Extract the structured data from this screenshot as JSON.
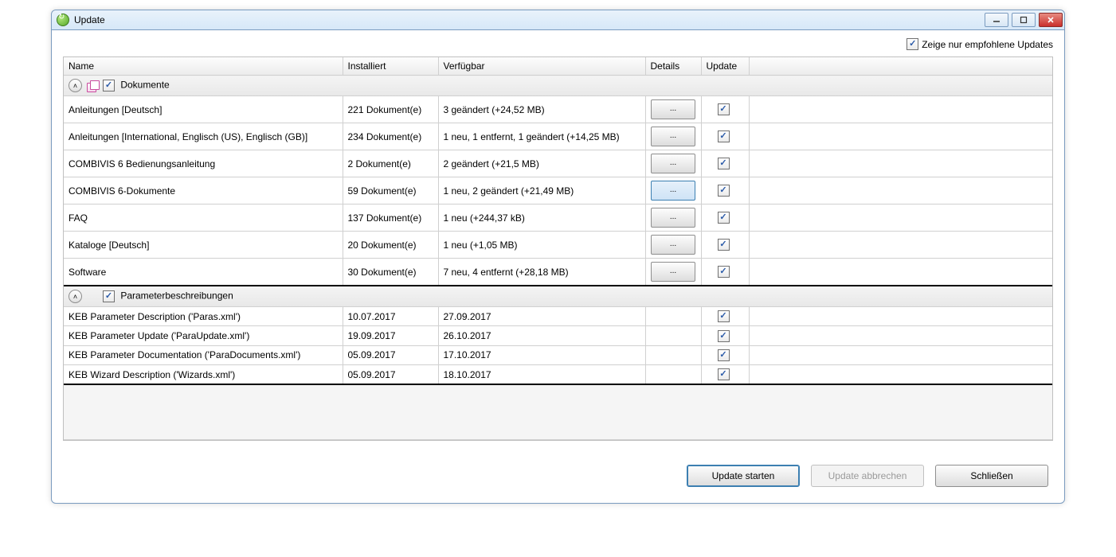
{
  "window": {
    "title": "Update"
  },
  "topcheck": {
    "label": "Zeige nur empfohlene Updates",
    "checked": true
  },
  "headers": {
    "name": "Name",
    "installed": "Installiert",
    "available": "Verfügbar",
    "details": "Details",
    "update": "Update"
  },
  "groups": [
    {
      "label": "Dokumente",
      "showFolderIcon": true,
      "checked": true,
      "rows": [
        {
          "name": "Anleitungen [Deutsch]",
          "installed": "221 Dokument(e)",
          "available": "3 geändert (+24,52 MB)",
          "details": true,
          "detailsHover": false,
          "update": true
        },
        {
          "name": "Anleitungen [International, Englisch (US), Englisch (GB)]",
          "installed": "234 Dokument(e)",
          "available": "1 neu, 1 entfernt, 1 geändert (+14,25 MB)",
          "details": true,
          "detailsHover": false,
          "update": true
        },
        {
          "name": "COMBIVIS 6 Bedienungsanleitung",
          "installed": "2 Dokument(e)",
          "available": "2 geändert (+21,5 MB)",
          "details": true,
          "detailsHover": false,
          "update": true
        },
        {
          "name": "COMBIVIS 6-Dokumente",
          "installed": "59 Dokument(e)",
          "available": "1 neu, 2 geändert (+21,49 MB)",
          "details": true,
          "detailsHover": true,
          "update": true
        },
        {
          "name": "FAQ",
          "installed": "137 Dokument(e)",
          "available": "1 neu (+244,37 kB)",
          "details": true,
          "detailsHover": false,
          "update": true
        },
        {
          "name": "Kataloge [Deutsch]",
          "installed": "20 Dokument(e)",
          "available": "1 neu (+1,05 MB)",
          "details": true,
          "detailsHover": false,
          "update": true
        },
        {
          "name": "Software",
          "installed": "30 Dokument(e)",
          "available": "7 neu, 4 entfernt (+28,18 MB)",
          "details": true,
          "detailsHover": false,
          "update": true
        }
      ]
    },
    {
      "label": "Parameterbeschreibungen",
      "showFolderIcon": false,
      "checked": true,
      "rows": [
        {
          "name": "KEB Parameter Description ('Paras.xml')",
          "installed": "10.07.2017",
          "available": "27.09.2017",
          "details": false,
          "update": true
        },
        {
          "name": "KEB Parameter Update ('ParaUpdate.xml')",
          "installed": "19.09.2017",
          "available": "26.10.2017",
          "details": false,
          "update": true
        },
        {
          "name": "KEB Parameter Documentation ('ParaDocuments.xml')",
          "installed": "05.09.2017",
          "available": "17.10.2017",
          "details": false,
          "update": true
        },
        {
          "name": "KEB Wizard Description ('Wizards.xml')",
          "installed": "05.09.2017",
          "available": "18.10.2017",
          "details": false,
          "update": true
        }
      ]
    }
  ],
  "footer": {
    "start": "Update starten",
    "cancel": "Update abbrechen",
    "close": "Schließen"
  }
}
